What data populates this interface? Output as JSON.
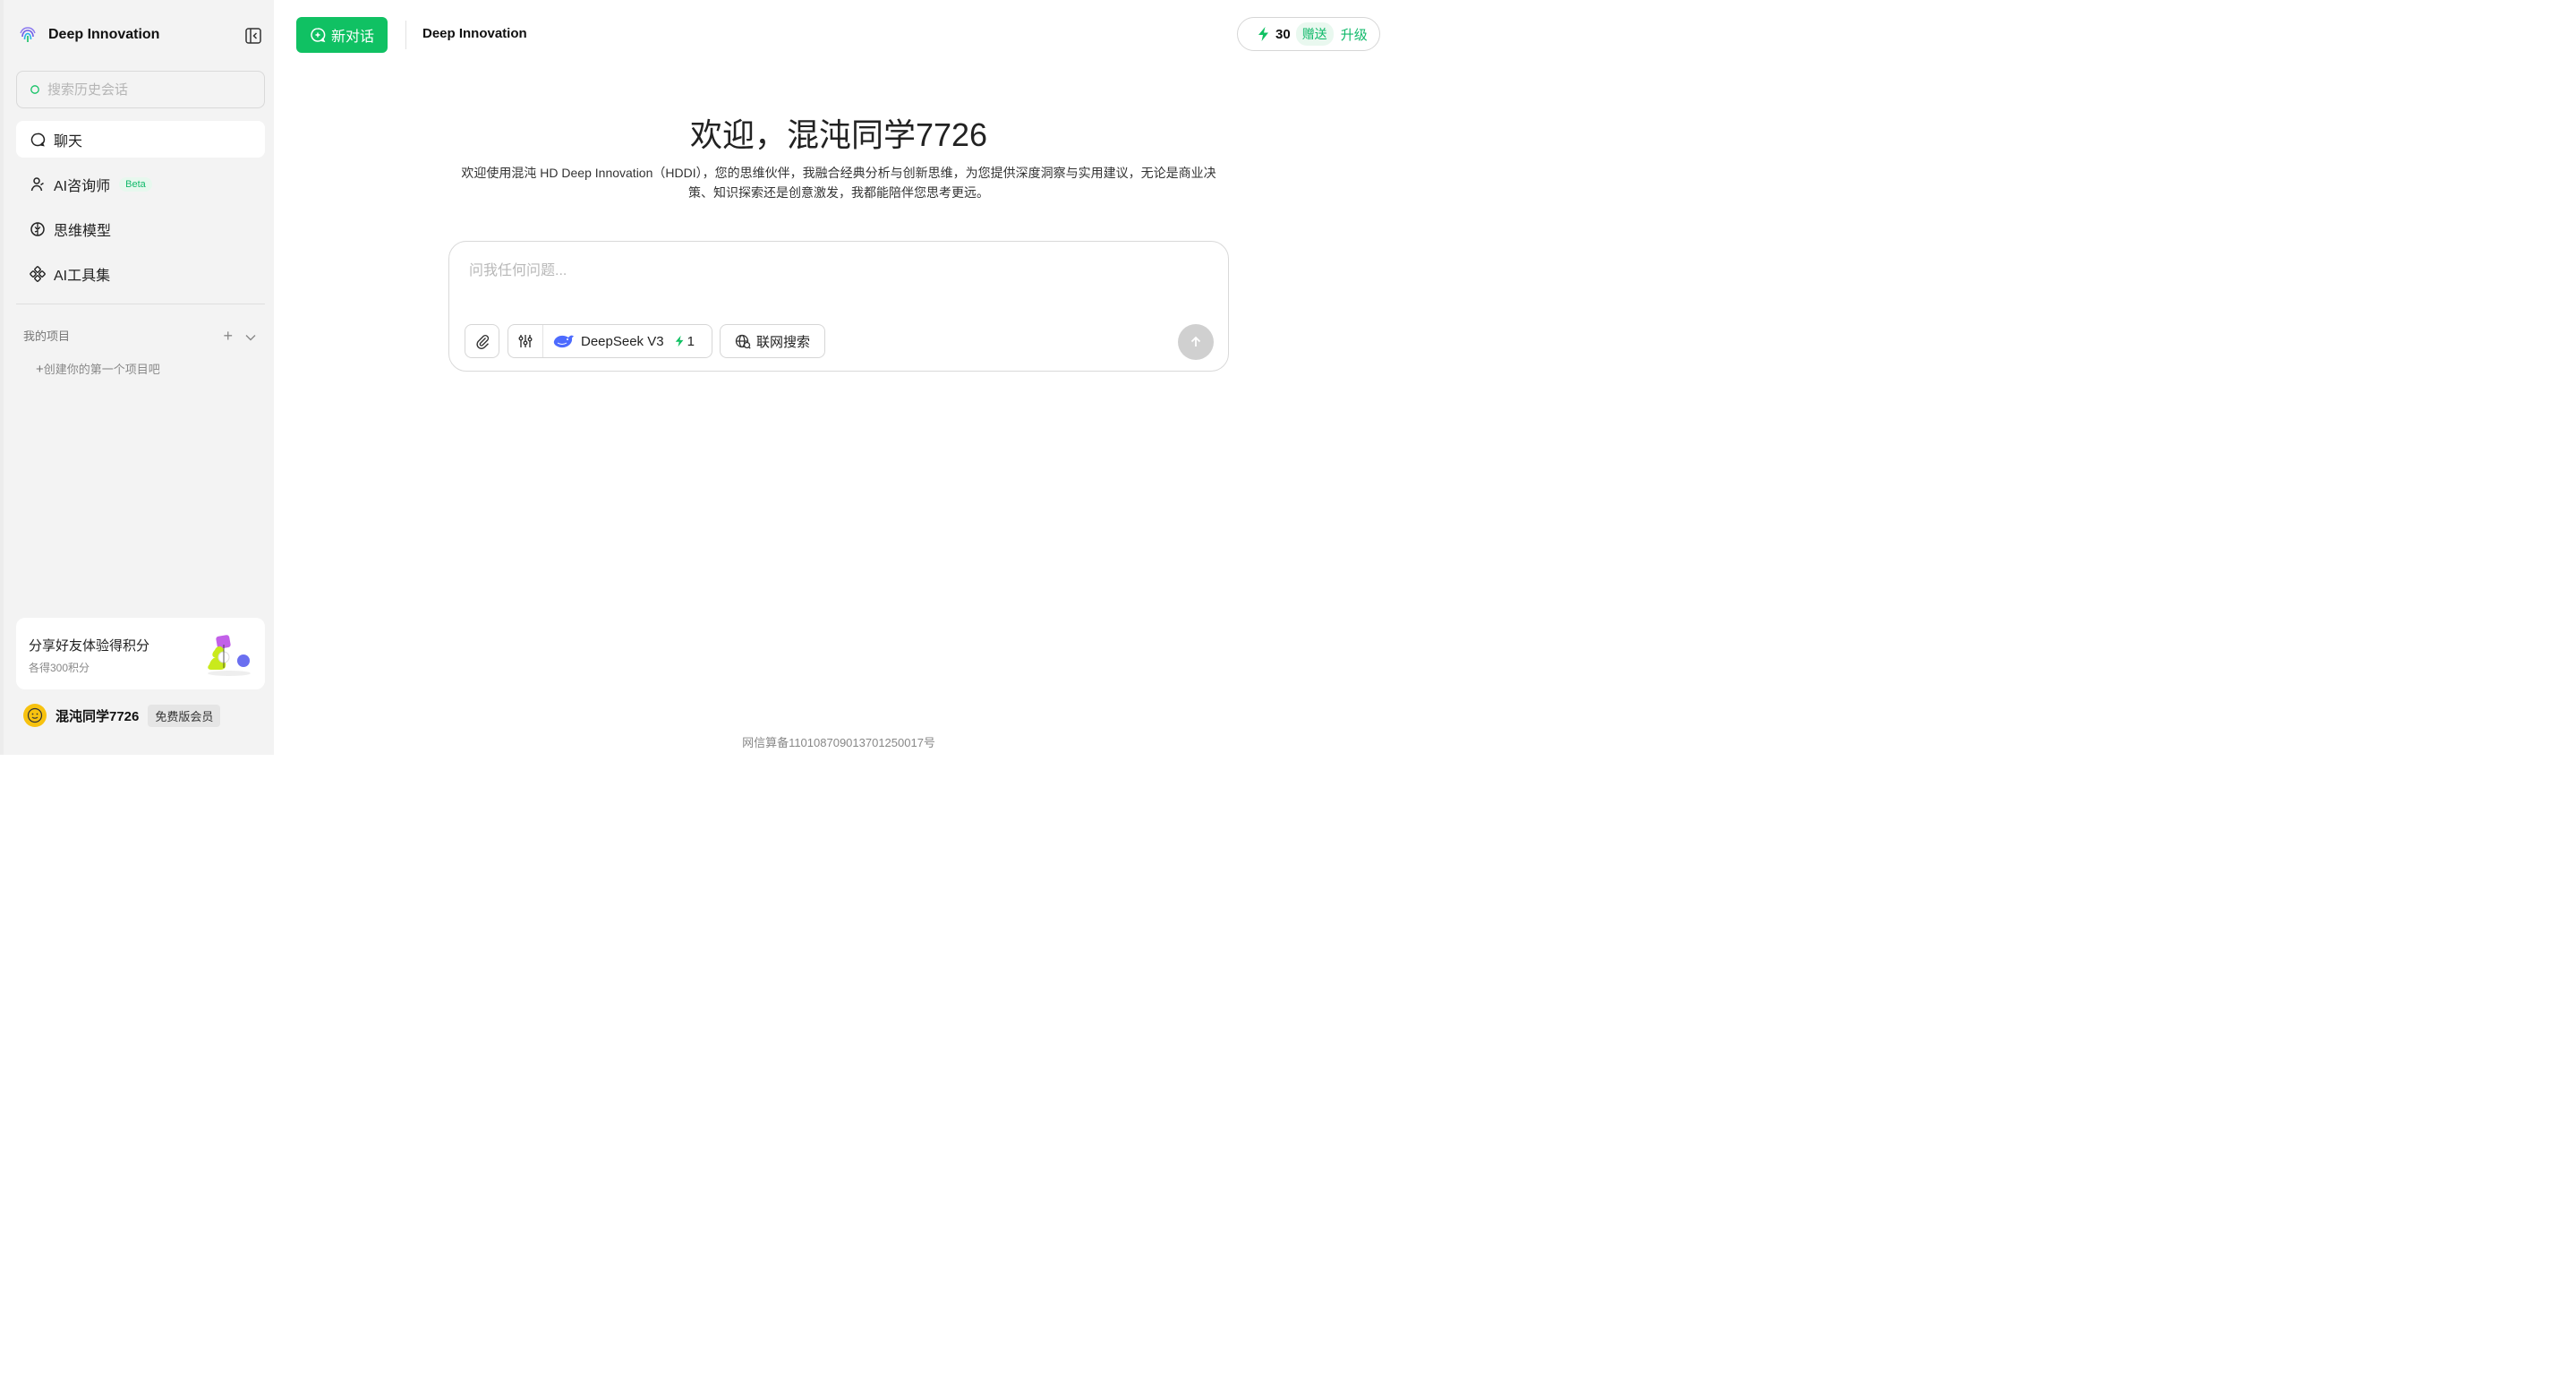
{
  "brand": {
    "name": "Deep Innovation"
  },
  "sidebar": {
    "search_placeholder": "搜索历史会话",
    "nav": [
      {
        "label": "聊天",
        "icon": "chat-icon",
        "active": true
      },
      {
        "label": "AI咨询师",
        "icon": "consultant-icon",
        "badge": "Beta"
      },
      {
        "label": "思维模型",
        "icon": "brain-icon"
      },
      {
        "label": "AI工具集",
        "icon": "tools-icon"
      }
    ],
    "projects": {
      "title": "我的项目",
      "create_label": "创建你的第一个项目吧"
    },
    "share": {
      "title": "分享好友体验得积分",
      "subtitle": "各得300积分"
    },
    "user": {
      "name": "混沌同学7726",
      "membership": "免费版会员"
    }
  },
  "header": {
    "new_chat_label": "新对话",
    "title": "Deep Innovation",
    "points": "30",
    "gift_label": "赠送",
    "upgrade_label": "升级"
  },
  "main": {
    "welcome": "欢迎，混沌同学7726",
    "intro": "欢迎使用混沌 HD Deep Innovation（HDDI），您的思维伙伴，我融合经典分析与创新思维，为您提供深度洞察与实用建议，无论是商业决策、知识探索还是创意激发，我都能陪伴您思考更远。",
    "input_placeholder": "问我任何问题...",
    "model_name": "DeepSeek V3",
    "model_cost": "1",
    "web_search_label": "联网搜索"
  },
  "footer": {
    "icp": "网信算备110108709013701250017号"
  },
  "colors": {
    "accent": "#10c163",
    "accent_soft": "#e9f8ef",
    "sidebar_bg": "#f3f3f3"
  }
}
